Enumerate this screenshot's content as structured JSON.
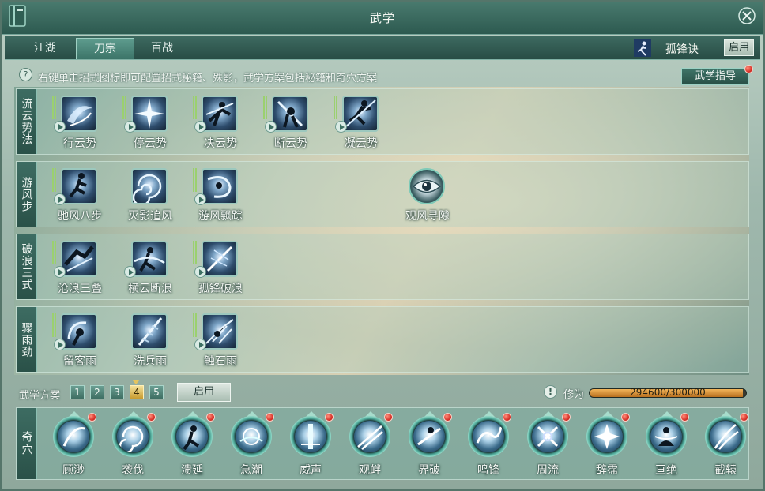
{
  "window": {
    "title": "武学"
  },
  "tabs": [
    {
      "label": "江湖",
      "active": false
    },
    {
      "label": "刀宗",
      "active": true
    },
    {
      "label": "百战",
      "active": false
    }
  ],
  "style_box": {
    "icon": "runner-icon",
    "name": "孤锋诀",
    "enable_label": "启用"
  },
  "hint": {
    "icon": "question-icon",
    "text": "右键单击招式图标即可配置招式秘籍、殊影，武学方案包括秘籍和奇穴方案"
  },
  "guide_button": {
    "label": "武学指导",
    "has_notification": true
  },
  "rows": [
    {
      "label": "流云势法",
      "skills": [
        {
          "name": "行云势",
          "icon": "swirl-slash-icon"
        },
        {
          "name": "停云势",
          "icon": "burst-strike-icon"
        },
        {
          "name": "决云势",
          "icon": "dash-strike-icon"
        },
        {
          "name": "断云势",
          "icon": "sword-parry-icon"
        },
        {
          "name": "凝云势",
          "icon": "leaping-slash-icon"
        }
      ]
    },
    {
      "label": "游风步",
      "skills": [
        {
          "name": "驰风八步",
          "icon": "running-step-icon"
        },
        {
          "name": "灭影追风",
          "icon": "vortex-icon"
        },
        {
          "name": "游风飘踪",
          "icon": "wind-trail-icon"
        },
        {
          "name": "观风寻隙",
          "icon": "eye-icon"
        }
      ]
    },
    {
      "label": "破浪三式",
      "skills": [
        {
          "name": "沧浪三叠",
          "icon": "triple-wave-icon"
        },
        {
          "name": "横云断浪",
          "icon": "cross-slash-icon"
        },
        {
          "name": "孤锋破浪",
          "icon": "lone-blade-icon"
        }
      ]
    },
    {
      "label": "骤雨劲",
      "skills": [
        {
          "name": "留客雨",
          "icon": "rain-spin-icon"
        },
        {
          "name": "洗兵雨",
          "icon": "blade-rain-icon"
        },
        {
          "name": "触石雨",
          "icon": "stone-rain-icon"
        }
      ]
    }
  ],
  "scheme": {
    "label": "武学方案",
    "options": [
      "1",
      "2",
      "3",
      "4",
      "5"
    ],
    "selected": "4",
    "enable_label": "启用"
  },
  "xiuwei": {
    "label": "修为",
    "text": "294600/300000",
    "current": 294600,
    "max": 300000
  },
  "qixue": {
    "label": "奇穴",
    "items": [
      {
        "name": "顾渺",
        "icon": "blade-arc-icon"
      },
      {
        "name": "袭伐",
        "icon": "spiral-icon"
      },
      {
        "name": "溃延",
        "icon": "warrior-icon"
      },
      {
        "name": "急潮",
        "icon": "tide-icon"
      },
      {
        "name": "威声",
        "icon": "pillar-light-icon"
      },
      {
        "name": "观衅",
        "icon": "streak-icon"
      },
      {
        "name": "界破",
        "icon": "shatter-icon"
      },
      {
        "name": "鸣锋",
        "icon": "wave-blade-icon"
      },
      {
        "name": "周流",
        "icon": "crossed-blades-icon"
      },
      {
        "name": "辞霈",
        "icon": "storm-icon"
      },
      {
        "name": "亘绝",
        "icon": "meditate-icon"
      },
      {
        "name": "截辕",
        "icon": "claw-slash-icon"
      }
    ]
  },
  "colors": {
    "accent": "#3c7468",
    "notification": "#d9332a",
    "scheme_active": "#c89b2f",
    "progress": "#f2b45a"
  }
}
